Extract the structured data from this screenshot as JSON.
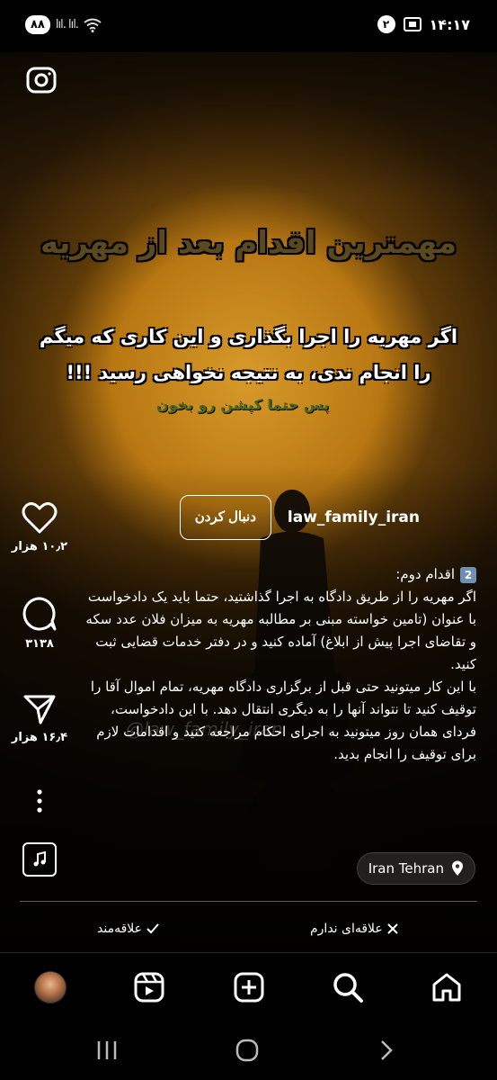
{
  "status_bar": {
    "time": "۱۴:۱۷",
    "battery": "۸۸",
    "notification_count": "۲",
    "signal_text": "lıl. lıl."
  },
  "reel": {
    "overlay_title": "مهمترین اقدام بعد از مهریه",
    "overlay_body_line1": "اگر مهریه را اجرا بگذاری و این کاری که میگم",
    "overlay_body_line2": "را انجام ندی، به نتیجه نخواهی رسید !!!",
    "overlay_note": "پس حتما کپشن رو بخون",
    "watermark": "@law_family_iran"
  },
  "actions": {
    "likes": "۱۰٫۲ هزار",
    "comments": "۳۱۳۸",
    "shares": "۱۶٫۴ هزار"
  },
  "author": {
    "username": "law_family_iran",
    "follow_label": "دنبال کردن"
  },
  "caption": {
    "step_badge": "2",
    "step_title": "اقدام دوم:",
    "paragraph1": "اگر مهریه را از طریق دادگاه به اجرا گذاشتید، حتما باید یک دادخواست با عنوان (تامین خواسته مبنی بر مطالبه مهریه به میزان فلان عدد سکه و تقاضای اجرا پیش از ابلاغ) آماده کنید و در دفتر خدمات قضایی ثبت کنید.",
    "paragraph2": "با این کار میتونید حتی قبل از برگزاری دادگاه مهریه، تمام اموال آقا را توقیف کنید تا نتواند آنها را به دیگری انتقال دهد. با این دادخواست، فردای همان روز میتونید به اجرای احکام مراجعه کنید و اقدامات لازم برای توقیف را انجام بدید."
  },
  "location": "Iran Tehran",
  "feedback": {
    "not_interested": "علاقه‌ای ندارم",
    "interested": "علاقه‌مند"
  },
  "icons": {
    "camera": "camera-icon",
    "like": "heart-icon",
    "comment": "comment-icon",
    "share": "send-icon",
    "more": "more-icon",
    "music": "music-icon",
    "location": "location-pin-icon",
    "home": "home-icon",
    "search": "search-icon",
    "create": "plus-square-icon",
    "reels": "reels-icon"
  }
}
